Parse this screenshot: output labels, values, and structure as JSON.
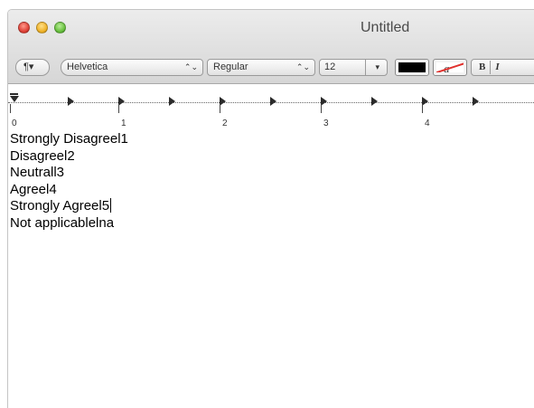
{
  "window": {
    "title": "Untitled"
  },
  "toolbar": {
    "paragraph_label": "¶▾",
    "font_family": "Helvetica",
    "font_style": "Regular",
    "font_size": "12",
    "popup_arrows": "⌃⌄",
    "dropdown_arrow": "▾",
    "text_color": "#000000",
    "background_color_glyph": "a",
    "bold_label": "B",
    "italic_label": "I"
  },
  "ruler": {
    "labels": [
      "0",
      "1",
      "2",
      "3",
      "4"
    ]
  },
  "document": {
    "lines": [
      "Strongly Disagreel1",
      "Disagreel2",
      "Neutrall3",
      "Agreel4",
      "Strongly Agreel5",
      "Not applicablelna"
    ]
  },
  "colors": {
    "close": "#e0443a",
    "minimize": "#f0b42c",
    "zoom": "#6bc241"
  },
  "icons": {
    "paragraph": "pilcrow-icon",
    "tab_stop": "tab-stop-icon",
    "indent": "indent-marker-icon"
  }
}
